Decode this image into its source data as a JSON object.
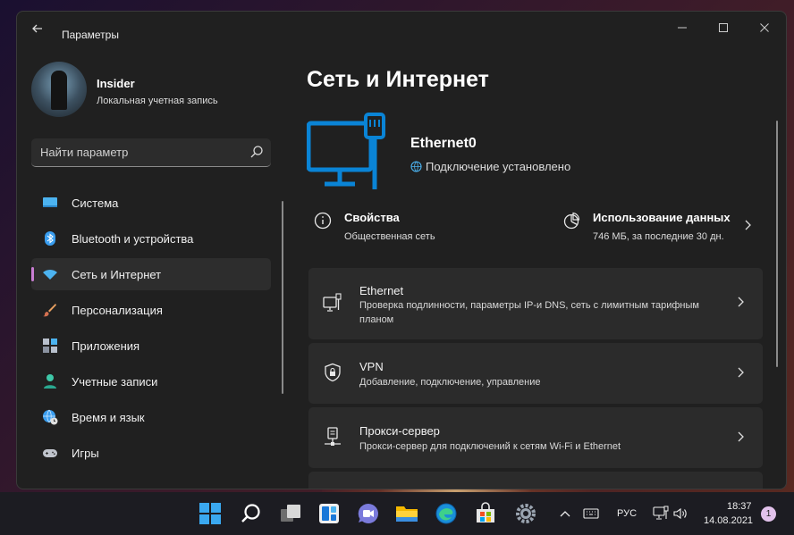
{
  "window": {
    "title": "Параметры"
  },
  "profile": {
    "name": "Insider",
    "account_type": "Локальная учетная запись"
  },
  "search": {
    "placeholder": "Найти параметр"
  },
  "sidebar": {
    "items": [
      {
        "label": "Система",
        "icon": "system-icon",
        "active": false
      },
      {
        "label": "Bluetooth и устройства",
        "icon": "bluetooth-icon",
        "active": false
      },
      {
        "label": "Сеть и Интернет",
        "icon": "wifi-icon",
        "active": true
      },
      {
        "label": "Персонализация",
        "icon": "brush-icon",
        "active": false
      },
      {
        "label": "Приложения",
        "icon": "apps-icon",
        "active": false
      },
      {
        "label": "Учетные записи",
        "icon": "user-icon",
        "active": false
      },
      {
        "label": "Время и язык",
        "icon": "globe-clock-icon",
        "active": false
      },
      {
        "label": "Игры",
        "icon": "gamepad-icon",
        "active": false
      }
    ]
  },
  "main": {
    "title": "Сеть и Интернет",
    "hero": {
      "name": "Ethernet0",
      "status": "Подключение установлено"
    },
    "properties": {
      "title": "Свойства",
      "subtitle": "Общественная сеть"
    },
    "usage": {
      "title": "Использование данных",
      "subtitle": "746 МБ, за последние 30 дн."
    },
    "cards": [
      {
        "title": "Ethernet",
        "description": "Проверка подлинности, параметры IP-и DNS, сеть с лимитным тарифным планом",
        "icon": "ethernet-icon"
      },
      {
        "title": "VPN",
        "description": "Добавление, подключение, управление",
        "icon": "vpn-shield-icon"
      },
      {
        "title": "Прокси-сервер",
        "description": "Прокси-сервер для подключений к сетям Wi-Fi и Ethernet",
        "icon": "proxy-icon"
      }
    ]
  },
  "taskbar": {
    "language": "РУС",
    "time": "18:37",
    "date": "14.08.2021",
    "notifications": "1"
  },
  "colors": {
    "accent": "#0a84d6",
    "window_bg": "#202020",
    "card_bg": "#2b2b2b",
    "active_indicator": "#c87dd2"
  }
}
